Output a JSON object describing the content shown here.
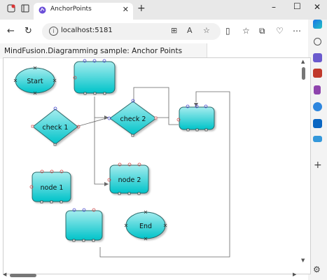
{
  "browser": {
    "tab_title": "AnchorPoints",
    "new_tab_label": "+",
    "url": "localhost:5181",
    "colors": {
      "tab_icon": "#6b4fd8",
      "accent": "#1a73e8"
    }
  },
  "page": {
    "title": "MindFusion.Diagramming sample: Anchor Points"
  },
  "diagram": {
    "nodes": {
      "start": "Start",
      "check1": "check 1",
      "check2": "check 2",
      "node1": "node 1",
      "node2": "node 2",
      "end": "End"
    },
    "colors": {
      "fill_top": "#8fe3e5",
      "fill_bottom": "#00c2c8",
      "stroke": "#2a6a6a",
      "anchor_in": "#4a4ad0",
      "anchor_out": "#d04a4a"
    }
  }
}
